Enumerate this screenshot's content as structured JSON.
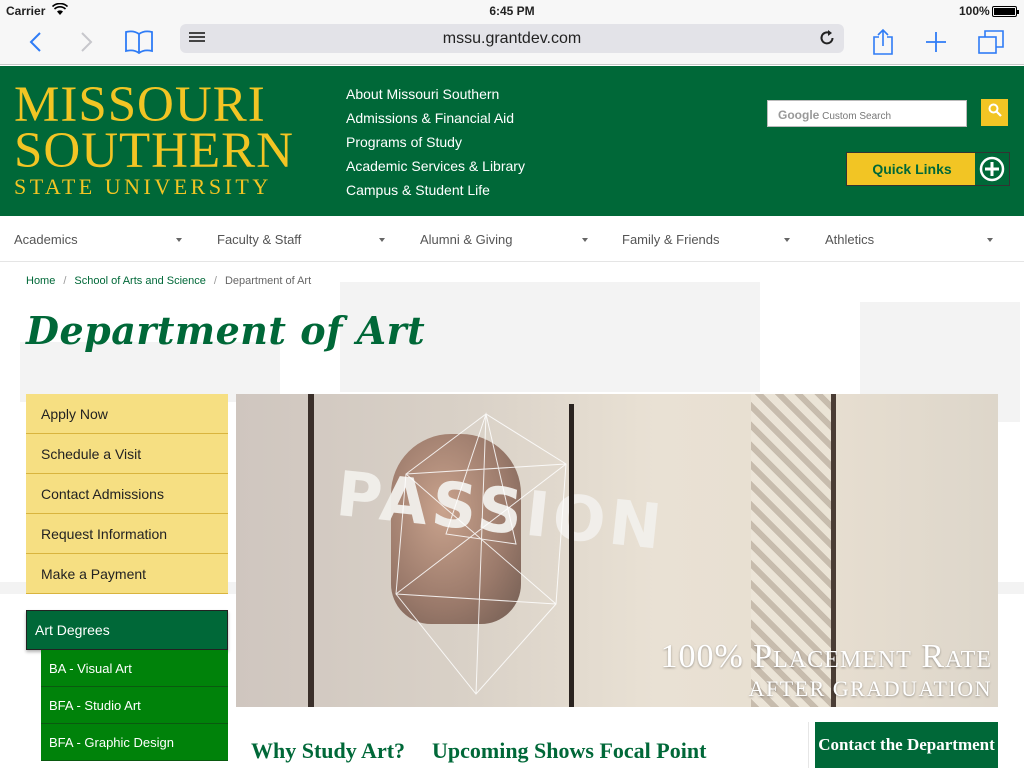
{
  "status_bar": {
    "carrier": "Carrier",
    "time": "6:45 PM",
    "battery": "100%"
  },
  "browser": {
    "url": "mssu.grantdev.com"
  },
  "header": {
    "logo_line1": "MISSOURI",
    "logo_line2": "SOUTHERN",
    "logo_line3": "STATE UNIVERSITY",
    "top_links": [
      "About Missouri Southern",
      "Admissions & Financial Aid",
      "Programs of Study",
      "Academic Services & Library",
      "Campus & Student Life"
    ],
    "search_placeholder_brand": "Google",
    "search_placeholder": "Custom Search",
    "quick_links": "Quick Links"
  },
  "main_nav": [
    "Academics",
    "Faculty & Staff",
    "Alumni & Giving",
    "Family & Friends",
    "Athletics"
  ],
  "breadcrumb": {
    "home": "Home",
    "school": "School of Arts and Science",
    "current": "Department of Art",
    "separator": "/"
  },
  "page_title": "Department of Art",
  "side_menu": [
    "Apply Now",
    "Schedule a Visit",
    "Contact Admissions",
    "Request Information",
    "Make a Payment"
  ],
  "degrees": {
    "heading": "Art Degrees",
    "items": [
      "BA - Visual Art",
      "BFA - Studio Art",
      "BFA - Graphic Design"
    ]
  },
  "hero": {
    "word": "PASSION",
    "caption_line1": "100% Placement Rate",
    "caption_line2": "AFTER GRADUATION"
  },
  "sections": {
    "why": "Why Study Art?",
    "shows": "Upcoming Shows Focal Point",
    "contact": "Contact the Department"
  },
  "colors": {
    "brand_green": "#006838",
    "brand_gold": "#f2c524",
    "menu_yellow": "#f6df82",
    "degree_green": "#00820a"
  }
}
